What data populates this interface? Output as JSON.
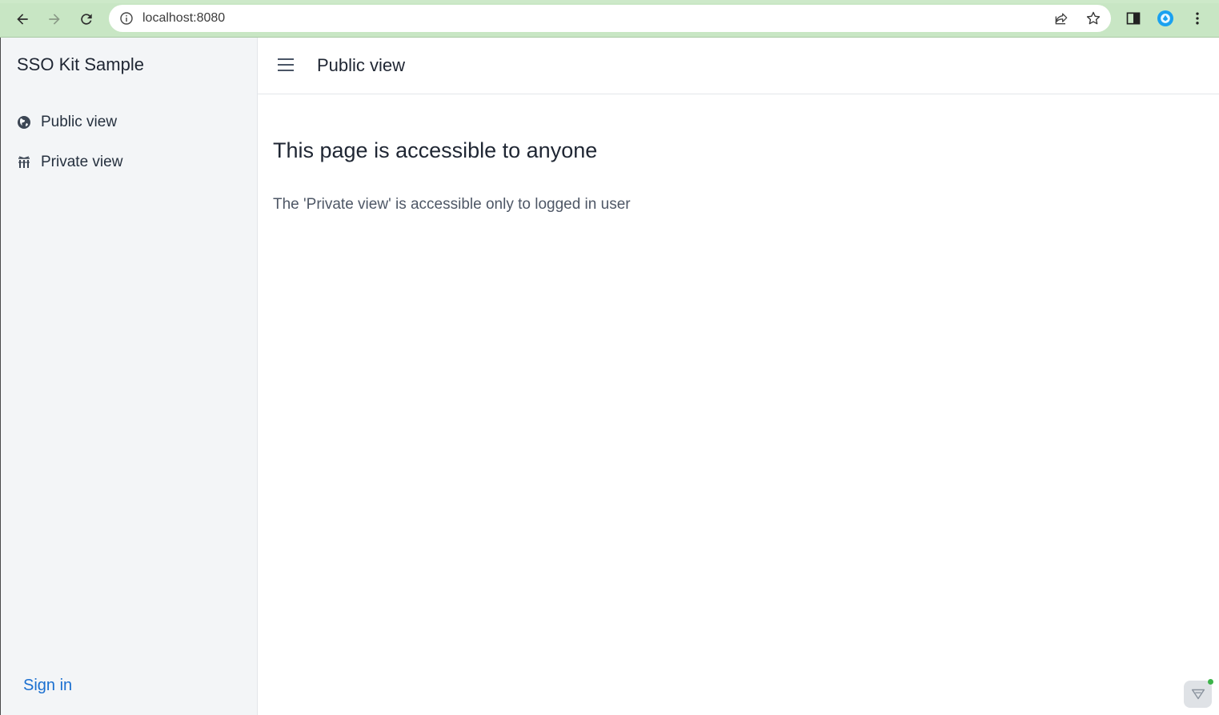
{
  "browser": {
    "url": "localhost:8080"
  },
  "sidebar": {
    "brand": "SSO Kit Sample",
    "items": [
      {
        "label": "Public view",
        "icon": "globe-icon"
      },
      {
        "label": "Private view",
        "icon": "building-icon"
      }
    ],
    "signin_label": "Sign in"
  },
  "header": {
    "title": "Public view"
  },
  "main": {
    "heading": "This page is accessible to anyone",
    "text": "The 'Private view' is accessible only to logged in user"
  },
  "colors": {
    "browser_bar": "#c8e6c4",
    "sidebar_bg": "#f3f5f7",
    "link": "#1a6fd0",
    "text_primary": "#1f2633",
    "text_secondary": "#4e5766"
  }
}
